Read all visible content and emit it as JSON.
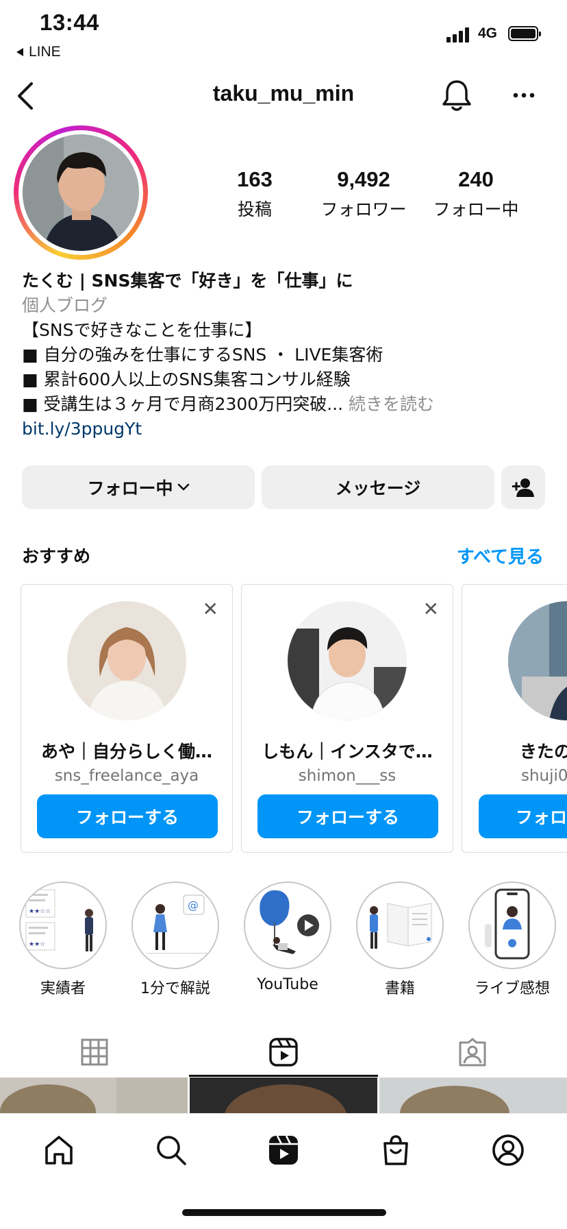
{
  "status_bar": {
    "time": "13:44",
    "back_app": "LINE",
    "network": "4G"
  },
  "header": {
    "username": "taku_mu_min"
  },
  "profile": {
    "stats": [
      {
        "value": "163",
        "label": "投稿"
      },
      {
        "value": "9,492",
        "label": "フォロワー"
      },
      {
        "value": "240",
        "label": "フォロー中"
      }
    ],
    "bio": {
      "name": "たくむ | SNS集客で「好き」を「仕事」に",
      "category": "個人ブログ",
      "lines": [
        "【SNSで好きなことを仕事に】",
        "■ 自分の強みを仕事にするSNS ・ LIVE集客術",
        "■ 累計600人以上のSNS集客コンサル経験",
        "■ 受講生は３ヶ月で月商2300万円突破..."
      ],
      "more": "続きを読む",
      "link": "bit.ly/3ppugYt"
    }
  },
  "actions": {
    "following": "フォロー中",
    "message": "メッセージ"
  },
  "suggestions": {
    "title": "おすすめ",
    "see_all": "すべて見る",
    "cards": [
      {
        "name": "あや｜自分らしく働…",
        "username": "sns_freelance_aya",
        "button": "フォローする"
      },
      {
        "name": "しもん｜インスタで…",
        "username": "shimon___ss",
        "button": "フォローする"
      },
      {
        "name": "きたの",
        "username": "shuji0",
        "button": "フォロ"
      }
    ]
  },
  "highlights": [
    {
      "label": "実績者"
    },
    {
      "label": "1分で解説"
    },
    {
      "label": "YouTube"
    },
    {
      "label": "書籍"
    },
    {
      "label": "ライブ感想"
    }
  ],
  "tabs": [
    {
      "name": "grid-icon",
      "active": false
    },
    {
      "name": "reels-icon",
      "active": true
    },
    {
      "name": "tagged-icon",
      "active": false
    }
  ],
  "bottom_nav": [
    "home-icon",
    "search-icon",
    "reels-icon",
    "shop-icon",
    "profile-icon"
  ],
  "colors": {
    "link_blue": "#0095f6",
    "bio_link": "#00376b",
    "button_gray": "#efefef"
  }
}
